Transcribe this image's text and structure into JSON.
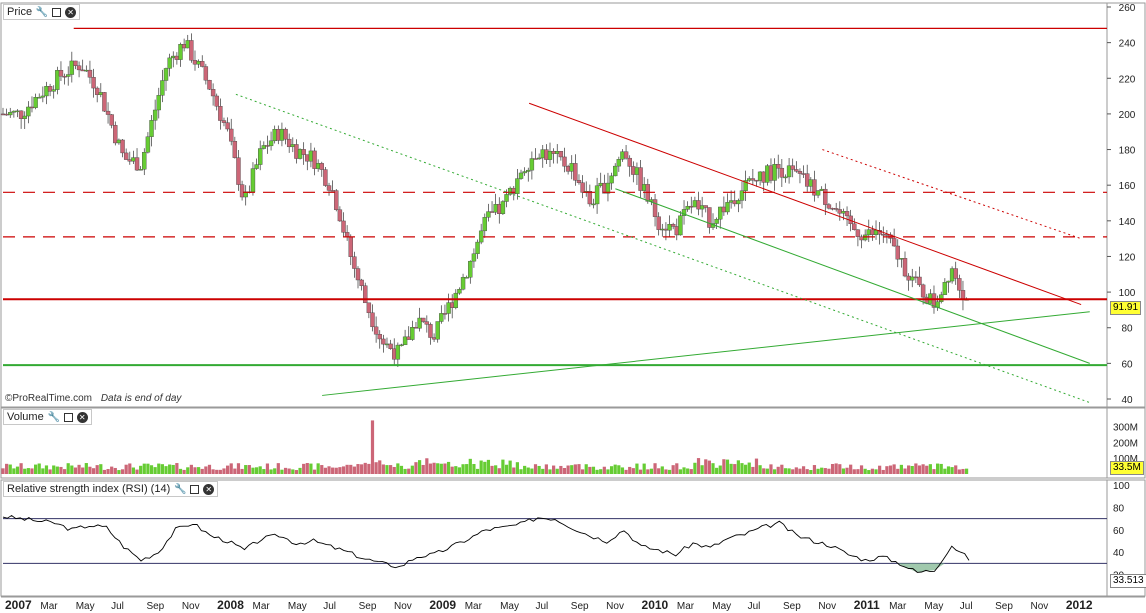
{
  "panels": {
    "price": {
      "title": "Price"
    },
    "volume": {
      "title": "Volume"
    },
    "rsi": {
      "title": "Relative strength index (RSI) (14)"
    }
  },
  "watermark": {
    "brand": "©ProRealTime.com",
    "note": "Data is end of day"
  },
  "badges": {
    "last_price": "91.91",
    "last_volume": "33.5M",
    "last_rsi": "33.513"
  },
  "colors": {
    "up": "#66cc33",
    "down": "#cc6677",
    "red_line": "#cc0000",
    "green_line": "#33aa33",
    "rsi_line": "#000000"
  },
  "chart_data": [
    {
      "type": "candlestick",
      "panel": "price",
      "y_ticks": [
        40,
        60,
        80,
        100,
        120,
        140,
        160,
        180,
        200,
        220,
        240,
        260
      ],
      "ylim": [
        40,
        260
      ],
      "x_labels": [
        "2007",
        "Mar",
        "May",
        "Jul",
        "Sep",
        "Nov",
        "2008",
        "Mar",
        "May",
        "Jul",
        "Sep",
        "Nov",
        "2009",
        "Mar",
        "May",
        "Jul",
        "Sep",
        "Nov",
        "2010",
        "Mar",
        "May",
        "Jul",
        "Sep",
        "Nov",
        "2011",
        "Mar",
        "May",
        "Jul",
        "Sep",
        "Nov",
        "2012"
      ],
      "close_path": [
        {
          "t": 0.0,
          "v": 200
        },
        {
          "t": 1.0,
          "v": 200
        },
        {
          "t": 2.0,
          "v": 210
        },
        {
          "t": 3.5,
          "v": 223
        },
        {
          "t": 4.5,
          "v": 228
        },
        {
          "t": 5.5,
          "v": 215
        },
        {
          "t": 7.0,
          "v": 175
        },
        {
          "t": 8.0,
          "v": 172
        },
        {
          "t": 9.5,
          "v": 228
        },
        {
          "t": 10.5,
          "v": 240
        },
        {
          "t": 11.0,
          "v": 232
        },
        {
          "t": 12.0,
          "v": 215
        },
        {
          "t": 13.0,
          "v": 190
        },
        {
          "t": 14.0,
          "v": 150
        },
        {
          "t": 15.0,
          "v": 180
        },
        {
          "t": 16.0,
          "v": 190
        },
        {
          "t": 17.0,
          "v": 180
        },
        {
          "t": 18.0,
          "v": 175
        },
        {
          "t": 19.0,
          "v": 160
        },
        {
          "t": 19.5,
          "v": 145
        },
        {
          "t": 20.0,
          "v": 125
        },
        {
          "t": 21.0,
          "v": 95
        },
        {
          "t": 22.0,
          "v": 72
        },
        {
          "t": 23.0,
          "v": 65
        },
        {
          "t": 24.0,
          "v": 85
        },
        {
          "t": 25.0,
          "v": 75
        },
        {
          "t": 26.0,
          "v": 95
        },
        {
          "t": 27.0,
          "v": 115
        },
        {
          "t": 28.0,
          "v": 140
        },
        {
          "t": 29.0,
          "v": 148
        },
        {
          "t": 30.0,
          "v": 168
        },
        {
          "t": 31.0,
          "v": 180
        },
        {
          "t": 32.0,
          "v": 175
        },
        {
          "t": 33.0,
          "v": 170
        },
        {
          "t": 34.0,
          "v": 150
        },
        {
          "t": 35.0,
          "v": 162
        },
        {
          "t": 36.0,
          "v": 180
        },
        {
          "t": 37.0,
          "v": 160
        },
        {
          "t": 38.0,
          "v": 140
        },
        {
          "t": 39.0,
          "v": 135
        },
        {
          "t": 40.0,
          "v": 150
        },
        {
          "t": 41.0,
          "v": 140
        },
        {
          "t": 42.0,
          "v": 150
        },
        {
          "t": 43.0,
          "v": 160
        },
        {
          "t": 44.0,
          "v": 165
        },
        {
          "t": 45.0,
          "v": 170
        },
        {
          "t": 46.0,
          "v": 165
        },
        {
          "t": 47.0,
          "v": 158
        },
        {
          "t": 48.0,
          "v": 150
        },
        {
          "t": 49.0,
          "v": 137
        },
        {
          "t": 50.0,
          "v": 132
        },
        {
          "t": 51.0,
          "v": 133
        },
        {
          "t": 52.0,
          "v": 118
        },
        {
          "t": 53.0,
          "v": 103
        },
        {
          "t": 54.0,
          "v": 93
        },
        {
          "t": 55.0,
          "v": 115
        },
        {
          "t": 56.0,
          "v": 92
        }
      ],
      "horizontal_lines": [
        {
          "value": 248,
          "color": "red",
          "style": "solid"
        },
        {
          "value": 156,
          "color": "red",
          "style": "dashed"
        },
        {
          "value": 131,
          "color": "red",
          "style": "dashed"
        },
        {
          "value": 96,
          "color": "red",
          "style": "solid"
        },
        {
          "value": 59,
          "color": "green",
          "style": "solid"
        }
      ],
      "trend_lines": [
        {
          "color": "green",
          "style": "dotted",
          "from": {
            "t": 13.5,
            "v": 211
          },
          "to": {
            "t": 63,
            "v": 38
          }
        },
        {
          "color": "red",
          "style": "solid",
          "from": {
            "t": 30.5,
            "v": 206
          },
          "to": {
            "t": 62.5,
            "v": 93
          }
        },
        {
          "color": "green",
          "style": "solid",
          "from": {
            "t": 35.5,
            "v": 158
          },
          "to": {
            "t": 63,
            "v": 60
          }
        },
        {
          "color": "green",
          "style": "solid",
          "from": {
            "t": 18.5,
            "v": 42
          },
          "to": {
            "t": 63,
            "v": 89
          }
        },
        {
          "color": "red",
          "style": "dotted",
          "from": {
            "t": 47.5,
            "v": 180
          },
          "to": {
            "t": 62.5,
            "v": 130
          }
        }
      ]
    },
    {
      "type": "bar",
      "panel": "volume",
      "y_ticks": [
        "100M",
        "200M",
        "300M"
      ],
      "ylim": [
        0,
        330
      ],
      "unit": "M",
      "spike": {
        "t": 21.5,
        "value": 340
      }
    },
    {
      "type": "line",
      "panel": "rsi",
      "y_ticks": [
        20,
        40,
        60,
        80,
        100
      ],
      "ylim": [
        0,
        100
      ],
      "bands": [
        70,
        30
      ],
      "path": [
        {
          "t": 0,
          "v": 72
        },
        {
          "t": 1,
          "v": 70
        },
        {
          "t": 2,
          "v": 68
        },
        {
          "t": 3,
          "v": 66
        },
        {
          "t": 4,
          "v": 60
        },
        {
          "t": 5,
          "v": 64
        },
        {
          "t": 6,
          "v": 62
        },
        {
          "t": 7,
          "v": 45
        },
        {
          "t": 8,
          "v": 33
        },
        {
          "t": 9,
          "v": 40
        },
        {
          "t": 10,
          "v": 60
        },
        {
          "t": 11,
          "v": 66
        },
        {
          "t": 12,
          "v": 55
        },
        {
          "t": 13,
          "v": 50
        },
        {
          "t": 14,
          "v": 42
        },
        {
          "t": 15,
          "v": 52
        },
        {
          "t": 16,
          "v": 55
        },
        {
          "t": 17,
          "v": 48
        },
        {
          "t": 18,
          "v": 50
        },
        {
          "t": 19,
          "v": 45
        },
        {
          "t": 20,
          "v": 40
        },
        {
          "t": 21,
          "v": 34
        },
        {
          "t": 22,
          "v": 30
        },
        {
          "t": 23,
          "v": 27
        },
        {
          "t": 24,
          "v": 36
        },
        {
          "t": 25,
          "v": 38
        },
        {
          "t": 26,
          "v": 45
        },
        {
          "t": 27,
          "v": 52
        },
        {
          "t": 28,
          "v": 60
        },
        {
          "t": 29,
          "v": 62
        },
        {
          "t": 30,
          "v": 65
        },
        {
          "t": 31,
          "v": 71
        },
        {
          "t": 32,
          "v": 70
        },
        {
          "t": 33,
          "v": 62
        },
        {
          "t": 34,
          "v": 55
        },
        {
          "t": 35,
          "v": 50
        },
        {
          "t": 36,
          "v": 60
        },
        {
          "t": 37,
          "v": 45
        },
        {
          "t": 38,
          "v": 42
        },
        {
          "t": 39,
          "v": 38
        },
        {
          "t": 40,
          "v": 48
        },
        {
          "t": 41,
          "v": 44
        },
        {
          "t": 42,
          "v": 52
        },
        {
          "t": 43,
          "v": 56
        },
        {
          "t": 44,
          "v": 62
        },
        {
          "t": 45,
          "v": 66
        },
        {
          "t": 46,
          "v": 55
        },
        {
          "t": 47,
          "v": 50
        },
        {
          "t": 48,
          "v": 46
        },
        {
          "t": 49,
          "v": 38
        },
        {
          "t": 50,
          "v": 33
        },
        {
          "t": 51,
          "v": 36
        },
        {
          "t": 52,
          "v": 30
        },
        {
          "t": 53,
          "v": 22
        },
        {
          "t": 54,
          "v": 24
        },
        {
          "t": 55,
          "v": 46
        },
        {
          "t": 56,
          "v": 34
        }
      ]
    }
  ]
}
